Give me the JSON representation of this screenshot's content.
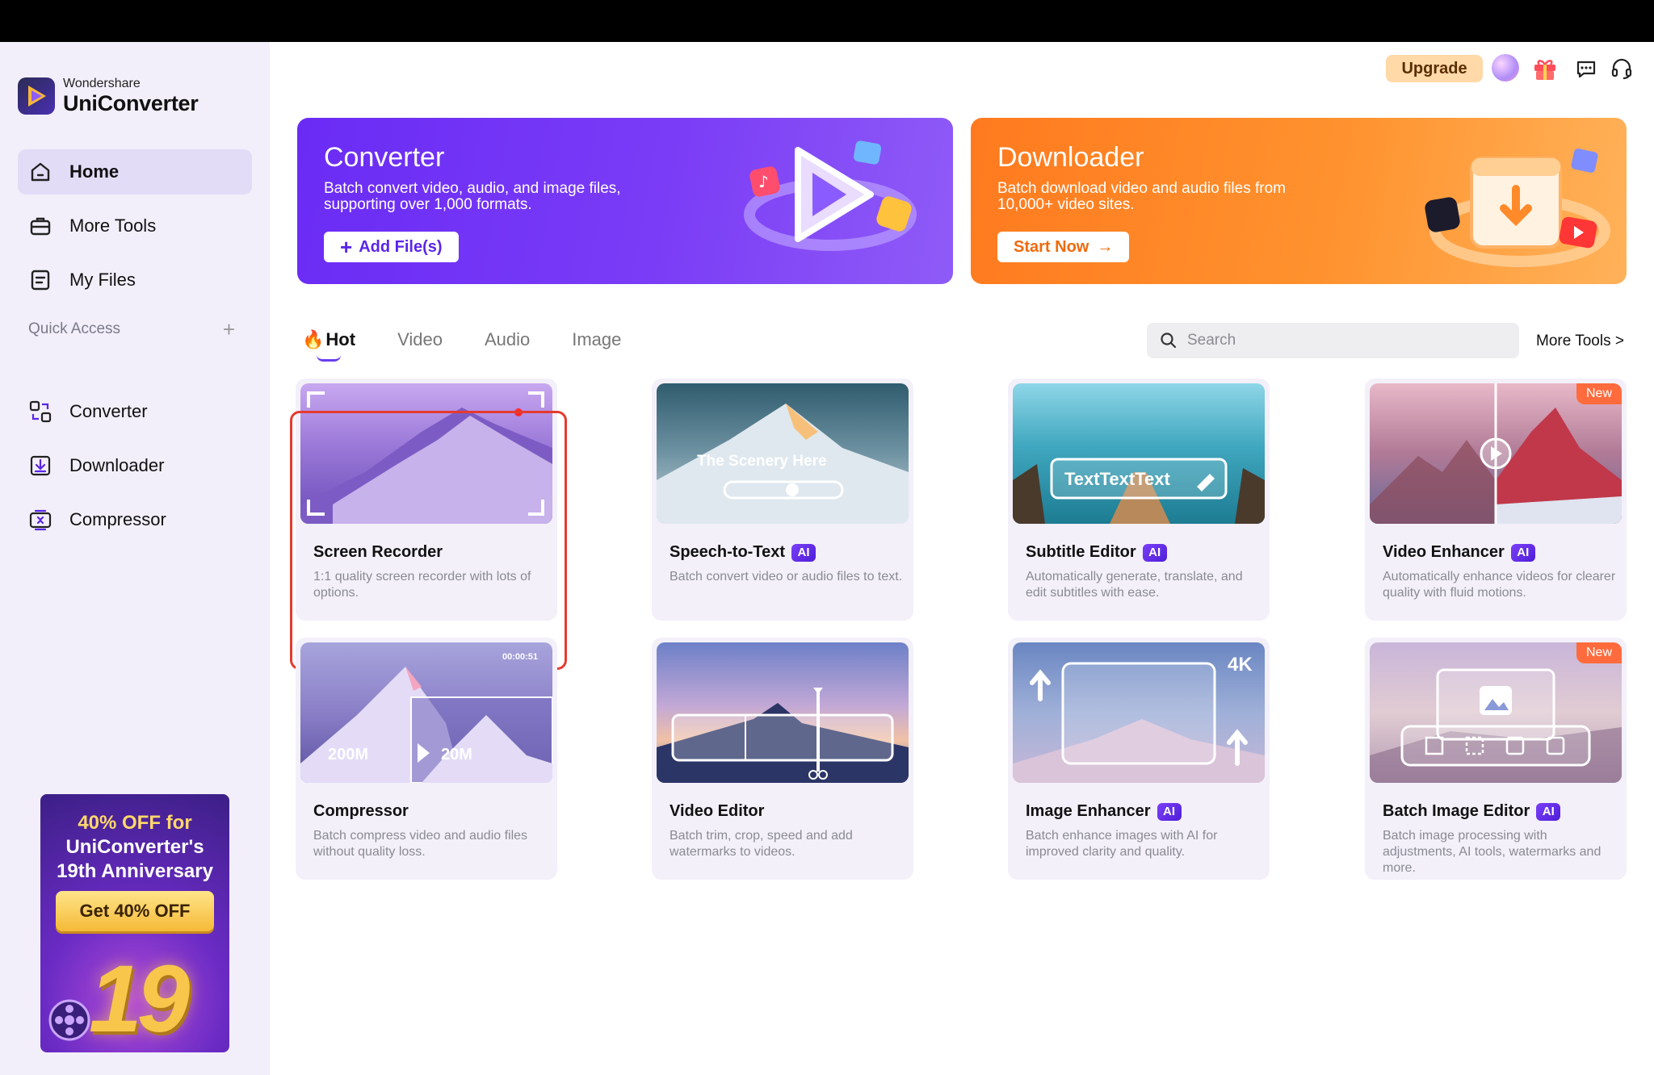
{
  "app": {
    "brand_sub": "Wondershare",
    "brand_main": "UniConverter"
  },
  "sidebar": {
    "nav": [
      {
        "label": "Home",
        "icon": "home-icon",
        "active": true
      },
      {
        "label": "More Tools",
        "icon": "toolbox-icon",
        "active": false
      },
      {
        "label": "My Files",
        "icon": "files-icon",
        "active": false
      }
    ],
    "quick_access_title": "Quick Access",
    "quick_access_add": "+",
    "quick_access": [
      {
        "label": "Converter",
        "icon": "converter-icon"
      },
      {
        "label": "Downloader",
        "icon": "downloader-icon"
      },
      {
        "label": "Compressor",
        "icon": "compressor-icon"
      }
    ],
    "promo": {
      "line1": "40% OFF for",
      "line2": "UniConverter's",
      "line3": "19th Anniversary",
      "button": "Get 40% OFF",
      "number": "19"
    }
  },
  "topbar": {
    "upgrade": "Upgrade",
    "icons": [
      "avatar",
      "gift-icon",
      "chat-icon",
      "headset-icon"
    ]
  },
  "banners": {
    "converter": {
      "title": "Converter",
      "desc": "Batch convert video, audio, and image files, supporting over 1,000 formats.",
      "button": "Add File(s)"
    },
    "downloader": {
      "title": "Downloader",
      "desc": "Batch download video and audio files from 10,000+ video sites.",
      "button": "Start Now"
    }
  },
  "tabs": [
    {
      "label": "Hot",
      "active": true
    },
    {
      "label": "Video",
      "active": false
    },
    {
      "label": "Audio",
      "active": false
    },
    {
      "label": "Image",
      "active": false
    }
  ],
  "search": {
    "placeholder": "Search",
    "value": ""
  },
  "more_tools_link": "More Tools >",
  "cards": [
    {
      "title": "Screen Recorder",
      "desc": "1:1 quality screen recorder with lots of options.",
      "ai": false,
      "new": false,
      "selected": true
    },
    {
      "title": "Speech-to-Text",
      "desc": "Batch convert video or audio files to text.",
      "ai": true,
      "new": false,
      "overlay": "The Scenery Here"
    },
    {
      "title": "Subtitle Editor",
      "desc": "Automatically generate, translate, and edit subtitles with ease.",
      "ai": true,
      "new": false,
      "overlay": "TextTextText"
    },
    {
      "title": "Video Enhancer",
      "desc": "Automatically enhance videos for clearer quality with fluid motions.",
      "ai": true,
      "new": true
    },
    {
      "title": "Compressor",
      "desc": "Batch compress video and audio files without quality loss.",
      "ai": false,
      "new": false,
      "timestamp": "00:00:51",
      "size_from": "200M",
      "size_to": "20M"
    },
    {
      "title": "Video Editor",
      "desc": "Batch trim, crop, speed and add watermarks to videos.",
      "ai": false,
      "new": false
    },
    {
      "title": "Image Enhancer",
      "desc": "Batch enhance images with AI for improved clarity and quality.",
      "ai": true,
      "new": false,
      "resolution": "4K"
    },
    {
      "title": "Batch Image Editor",
      "desc": "Batch image processing with adjustments, AI tools, watermarks and more.",
      "ai": true,
      "new": true
    }
  ],
  "badges": {
    "ai": "AI",
    "new": "New"
  },
  "colors": {
    "accent": "#6a3ef3",
    "converter_banner": "#6a2bf5",
    "downloader_banner": "#ff7a1e",
    "selection": "#e53a2f"
  }
}
